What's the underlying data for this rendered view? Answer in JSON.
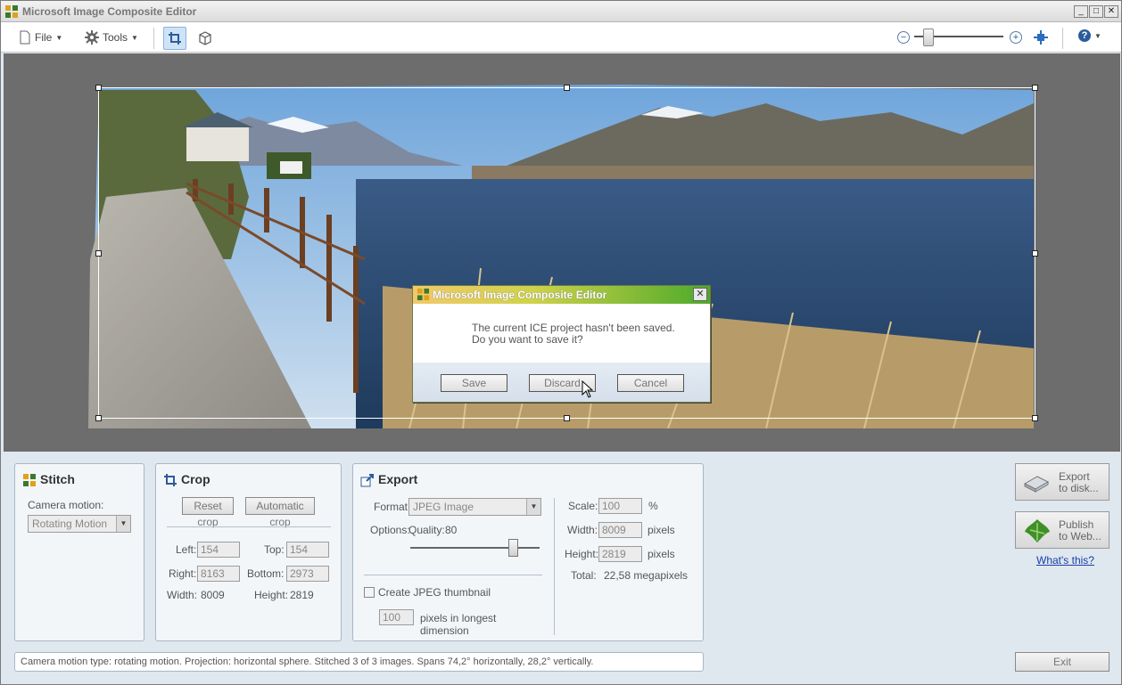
{
  "window": {
    "title": "Microsoft Image Composite Editor"
  },
  "toolbar": {
    "file_label": "File",
    "tools_label": "Tools"
  },
  "dialog": {
    "title": "Microsoft Image Composite Editor",
    "message_line1": "The current ICE project hasn't been saved.",
    "message_line2": "Do you want to save it?",
    "save": "Save",
    "discard": "Discard",
    "cancel": "Cancel"
  },
  "stitch": {
    "title": "Stitch",
    "camera_motion_label": "Camera motion:",
    "camera_motion_value": "Rotating Motion"
  },
  "crop": {
    "title": "Crop",
    "reset_button": "Reset crop",
    "auto_button": "Automatic crop",
    "left_label": "Left:",
    "left_value": "154",
    "top_label": "Top:",
    "top_value": "154",
    "right_label": "Right:",
    "right_value": "8163",
    "bottom_label": "Bottom:",
    "bottom_value": "2973",
    "width_label": "Width:",
    "width_value": "8009",
    "height_label": "Height:",
    "height_value": "2819"
  },
  "export": {
    "title": "Export",
    "format_label": "Format:",
    "format_value": "JPEG Image",
    "options_label": "Options:",
    "quality_label": "Quality:",
    "quality_value": "80",
    "quality_fraction": 0.8,
    "thumbnail_label": "Create JPEG thumbnail",
    "thumbnail_size": "100",
    "thumbnail_unit_line1": "pixels in longest",
    "thumbnail_unit_line2": "dimension",
    "scale_label": "Scale:",
    "scale_value": "100",
    "scale_unit": "%",
    "width_label": "Width:",
    "width_value": "8009",
    "width_unit": "pixels",
    "height_label": "Height:",
    "height_value": "2819",
    "height_unit": "pixels",
    "total_label": "Total:",
    "total_value": "22,58 megapixels"
  },
  "actions": {
    "export_disk_line1": "Export",
    "export_disk_line2": "to disk...",
    "publish_web_line1": "Publish",
    "publish_web_line2": "to Web...",
    "whats_this": "What's this?",
    "exit": "Exit"
  },
  "status": {
    "text": "Camera motion type: rotating motion. Projection: horizontal sphere. Stitched 3 of 3 images. Spans 74,2° horizontally, 28,2° vertically."
  }
}
